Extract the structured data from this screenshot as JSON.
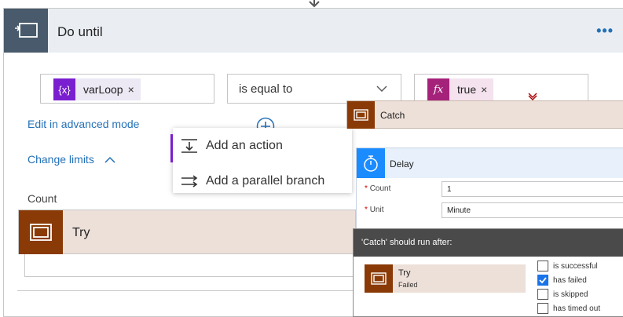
{
  "do_until": {
    "title": "Do until",
    "more_label": "•••",
    "condition": {
      "left_token": {
        "icon_text": "{x}",
        "label": "varLoop",
        "remove": "×",
        "color": "#7a1fcf"
      },
      "operator": "is equal to",
      "right_token": {
        "icon_text": "fx",
        "label": "true",
        "remove": "×",
        "color": "#a4227a"
      }
    },
    "edit_advanced_label": "Edit in advanced mode",
    "change_limits_label": "Change limits",
    "count_label": "Count"
  },
  "popup_menu": {
    "items": [
      {
        "label": "Add an action",
        "icon": "add-action-icon"
      },
      {
        "label": "Add a parallel branch",
        "icon": "parallel-branch-icon"
      }
    ]
  },
  "try_scope": {
    "title": "Try",
    "color": "#8a3a06"
  },
  "catch_scope": {
    "title": "Catch"
  },
  "delay_action": {
    "title": "Delay",
    "fields": [
      {
        "label": "Count",
        "value": "1"
      },
      {
        "label": "Unit",
        "value": "Minute"
      }
    ]
  },
  "run_after": {
    "title": "'Catch' should run after:",
    "action_name": "Try",
    "action_status": "Failed",
    "options": [
      {
        "label": "is successful",
        "checked": false
      },
      {
        "label": "has failed",
        "checked": true
      },
      {
        "label": "is skipped",
        "checked": false
      },
      {
        "label": "has timed out",
        "checked": false
      }
    ]
  },
  "colors": {
    "accent_blue": "#2471b8",
    "scope_brown": "#8a3a06",
    "delay_blue": "#1a8cff",
    "header_gray": "#485a6b"
  }
}
